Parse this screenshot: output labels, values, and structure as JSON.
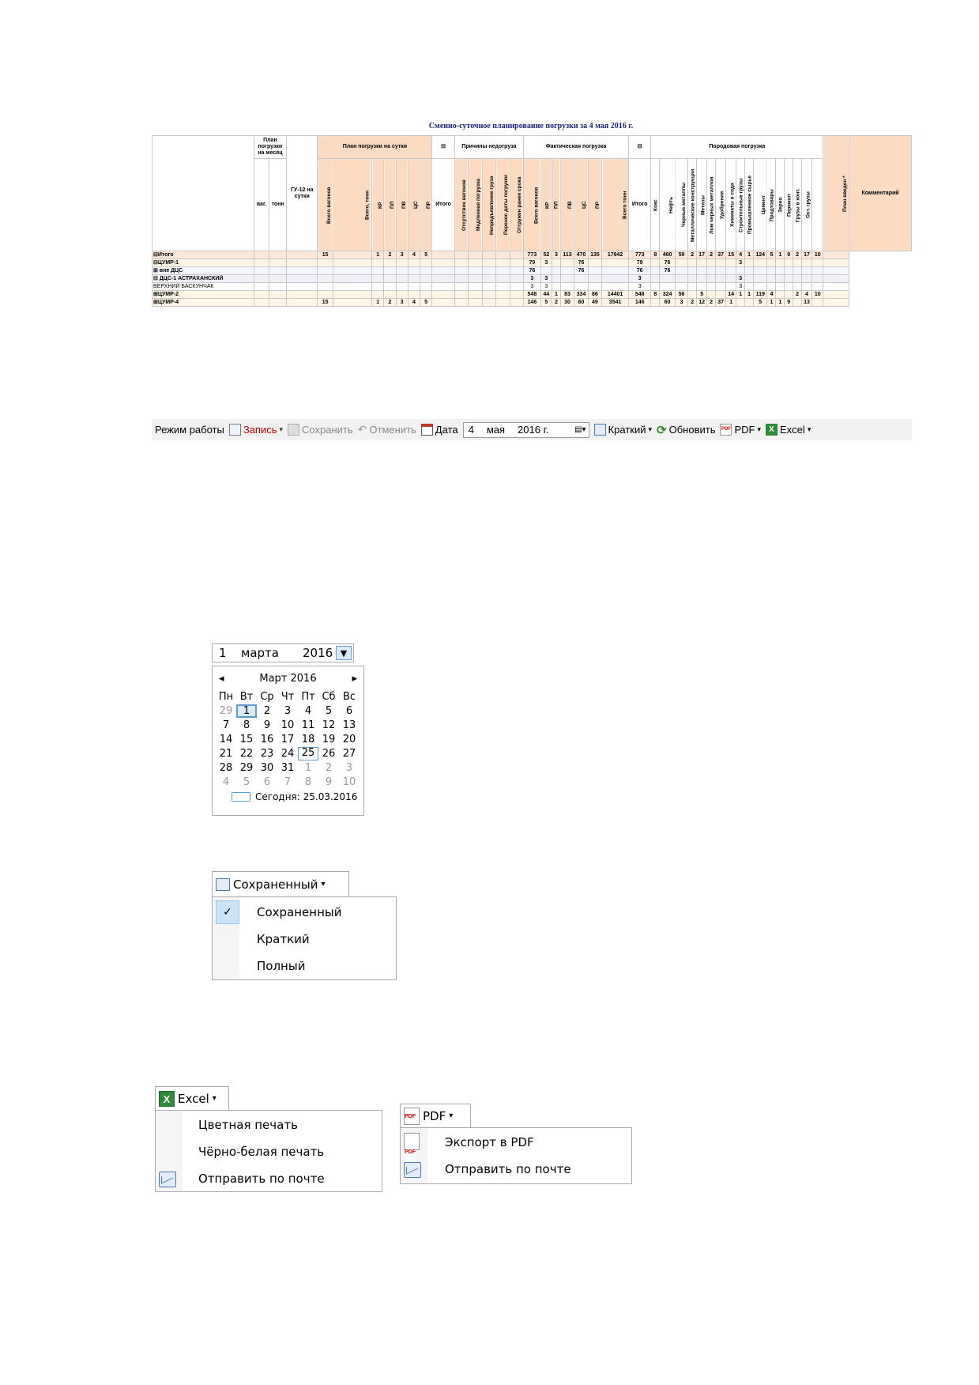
{
  "report": {
    "title": "Сменно-суточное планирование погрузки за 4 мая 2016 г.",
    "headers": {
      "plan_month": "План погрузки на месяц",
      "vag": "ваг.",
      "tonn": "тонн",
      "gu12": "ГУ-12 на сутки",
      "plan_day": "План погрузки на сутки",
      "plan_day_cols": [
        "Всего вагонов",
        "Всего, тонн",
        "КР",
        "ПЛ",
        "ПВ",
        "ЦС",
        "ПР"
      ],
      "reasons": "Причины недогруза",
      "reasons_total": "Итого",
      "reasons_cols": [
        "Отсутствие вагонов",
        "Медленная погрузка",
        "Непредъявление груза",
        "Перенос даты погрузки",
        "Отгружен ранее срока"
      ],
      "actual": "Фактическая погрузка",
      "actual_cols": [
        "Всего вагонов",
        "КР",
        "ПЛ",
        "ПВ",
        "ЦС",
        "ПР",
        "Всего тонн"
      ],
      "cargo": "Породовая погрузка",
      "cargo_total": "Итого",
      "cargo_cols": [
        "Кокс",
        "Нефть",
        "Черные металлы",
        "Металлические конструкции",
        "Метизы",
        "Лом черных металлов",
        "Удобрения",
        "Химикаты и сода",
        "Строительные грузы",
        "Промышленное сырье",
        "Цемент",
        "Продтовары",
        "Зерно",
        "Перемол",
        "Грузы в конт.",
        "Ост. грузы"
      ],
      "plan_entered": "План введен *",
      "comment": "Комментарий",
      "collapse": "⊟"
    },
    "rows": [
      {
        "label": "⊟Итого",
        "plan_day": [
          "15",
          "",
          "1",
          "2",
          "3",
          "4",
          "5"
        ],
        "actual": [
          "773",
          "52",
          "3",
          "113",
          "470",
          "135",
          "17942"
        ],
        "cargo_total": "773",
        "cargo": [
          "8",
          "460",
          "59",
          "2",
          "17",
          "2",
          "37",
          "15",
          "4",
          "1",
          "124",
          "5",
          "1",
          "9",
          "2",
          "17",
          "10"
        ]
      },
      {
        "label": "⊟ЦУМР-1",
        "plan_day": [
          "",
          "",
          "",
          "",
          "",
          "",
          ""
        ],
        "actual": [
          "79",
          "3",
          "",
          "",
          "76",
          "",
          ""
        ],
        "cargo_total": "79",
        "cargo": [
          "",
          "76",
          "",
          "",
          "",
          "",
          "",
          "",
          "3",
          "",
          "",
          "",
          "",
          "",
          "",
          "",
          ""
        ]
      },
      {
        "label": "⊞ вне ДЦС",
        "plan_day": [
          "",
          "",
          "",
          "",
          "",
          "",
          ""
        ],
        "actual": [
          "76",
          "",
          "",
          "",
          "76",
          "",
          ""
        ],
        "cargo_total": "76",
        "cargo": [
          "",
          "76",
          "",
          "",
          "",
          "",
          "",
          "",
          "",
          "",
          "",
          "",
          "",
          "",
          "",
          "",
          ""
        ]
      },
      {
        "label": "⊟ ДЦС-1 АСТРАХАНСКИЙ",
        "plan_day": [
          "",
          "",
          "",
          "",
          "",
          "",
          ""
        ],
        "actual": [
          "3",
          "3",
          "",
          "",
          "",
          "",
          ""
        ],
        "cargo_total": "3",
        "cargo": [
          "",
          "",
          "",
          "",
          "",
          "",
          "",
          "",
          "3",
          "",
          "",
          "",
          "",
          "",
          "",
          "",
          ""
        ]
      },
      {
        "label": "ВЕРХНИЙ БАСКУНЧАК",
        "plan_day": [
          "",
          "",
          "",
          "",
          "",
          "",
          ""
        ],
        "actual": [
          "3",
          "3",
          "",
          "",
          "",
          "",
          ""
        ],
        "cargo_total": "3",
        "cargo": [
          "",
          "",
          "",
          "",
          "",
          "",
          "",
          "",
          "3",
          "",
          "",
          "",
          "",
          "",
          "",
          "",
          ""
        ]
      },
      {
        "label": "⊞ЦУМР-2",
        "plan_day": [
          "",
          "",
          "",
          "",
          "",
          "",
          ""
        ],
        "actual": [
          "548",
          "44",
          "1",
          "83",
          "334",
          "86",
          "14401"
        ],
        "cargo_total": "548",
        "cargo": [
          "8",
          "324",
          "56",
          "",
          "5",
          "",
          "",
          "14",
          "1",
          "1",
          "119",
          "4",
          "",
          "",
          "2",
          "4",
          "10"
        ]
      },
      {
        "label": "⊞ЦУМР-4",
        "plan_day": [
          "15",
          "",
          "1",
          "2",
          "3",
          "4",
          "5"
        ],
        "actual": [
          "146",
          "5",
          "2",
          "30",
          "60",
          "49",
          "3541"
        ],
        "cargo_total": "146",
        "cargo": [
          "",
          "60",
          "3",
          "2",
          "12",
          "2",
          "37",
          "1",
          "",
          "",
          "5",
          "1",
          "1",
          "9",
          "",
          "13",
          ""
        ]
      }
    ]
  },
  "toolbar": {
    "mode_label": "Режим работы",
    "record": "Запись",
    "save": "Сохранить",
    "cancel": "Отменить",
    "date_label": "Дата",
    "date_day": "4",
    "date_month": "мая",
    "date_year": "2016 г.",
    "view": "Краткий",
    "refresh": "Обновить",
    "pdf": "PDF",
    "excel": "Excel"
  },
  "calendar": {
    "input_day": "1",
    "input_month": "марта",
    "input_year": "2016 г.",
    "month_title": "Март 2016",
    "prev": "◂",
    "next": "▸",
    "weekdays": [
      "Пн",
      "Вт",
      "Ср",
      "Чт",
      "Пт",
      "Сб",
      "Вс"
    ],
    "days": [
      [
        "29",
        "1",
        "2",
        "3",
        "4",
        "5",
        "6"
      ],
      [
        "7",
        "8",
        "9",
        "10",
        "11",
        "12",
        "13"
      ],
      [
        "14",
        "15",
        "16",
        "17",
        "18",
        "19",
        "20"
      ],
      [
        "21",
        "22",
        "23",
        "24",
        "25",
        "26",
        "27"
      ],
      [
        "28",
        "29",
        "30",
        "31",
        "1",
        "2",
        "3"
      ],
      [
        "4",
        "5",
        "6",
        "7",
        "8",
        "9",
        "10"
      ]
    ],
    "today_label": "Сегодня: 25.03.2016"
  },
  "view_menu": {
    "button": "Сохраненный",
    "items": [
      "Сохраненный",
      "Краткий",
      "Полный"
    ],
    "checked_index": 0
  },
  "excel_menu": {
    "button": "Excel",
    "items": [
      "Цветная печать",
      "Чёрно-белая печать",
      "Отправить по почте"
    ]
  },
  "pdf_menu": {
    "button": "PDF",
    "items": [
      "Экспорт в PDF",
      "Отправить по почте"
    ]
  }
}
